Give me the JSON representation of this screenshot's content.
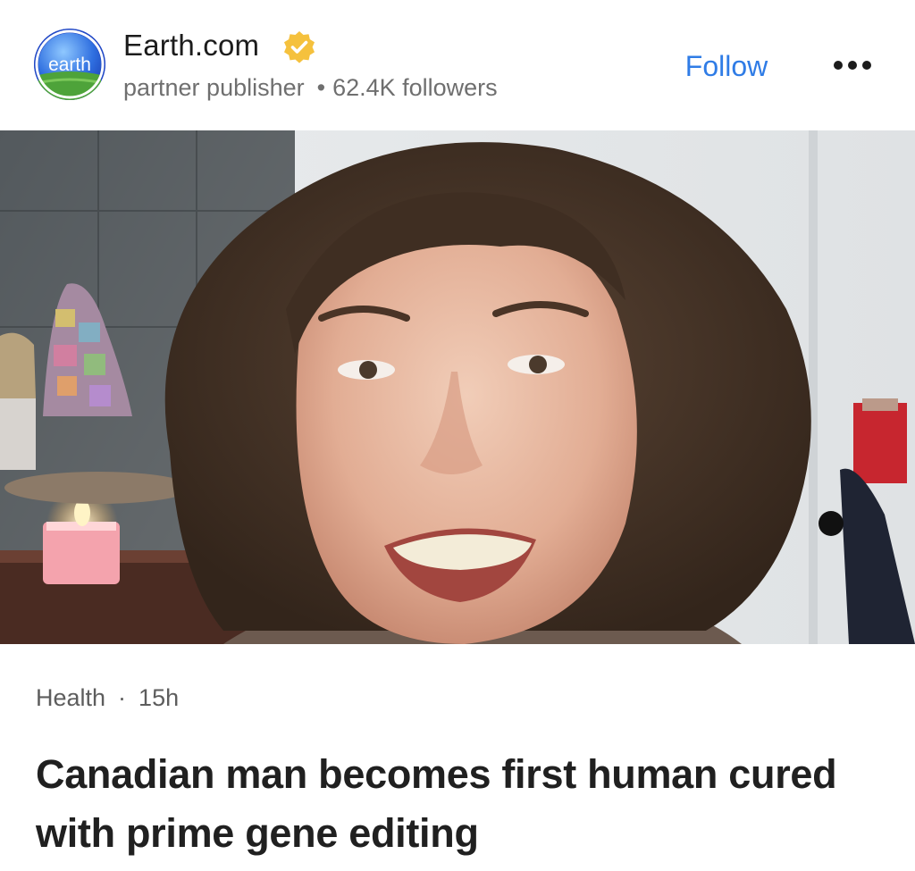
{
  "publisher": {
    "name": "Earth.com",
    "avatar_text": "earth",
    "verified": true,
    "type": "partner publisher",
    "separator": "•",
    "followers": "62.4K followers"
  },
  "actions": {
    "follow_label": "Follow",
    "more_icon": "more-horizontal-icon"
  },
  "article": {
    "category": "Health",
    "separator": "·",
    "time_ago": "15h",
    "headline": "Canadian man becomes first human cured with prime gene editing"
  },
  "colors": {
    "follow": "#2f7ce6",
    "verified_badge": "#f5c13d",
    "avatar_bg": "#2148c6"
  }
}
